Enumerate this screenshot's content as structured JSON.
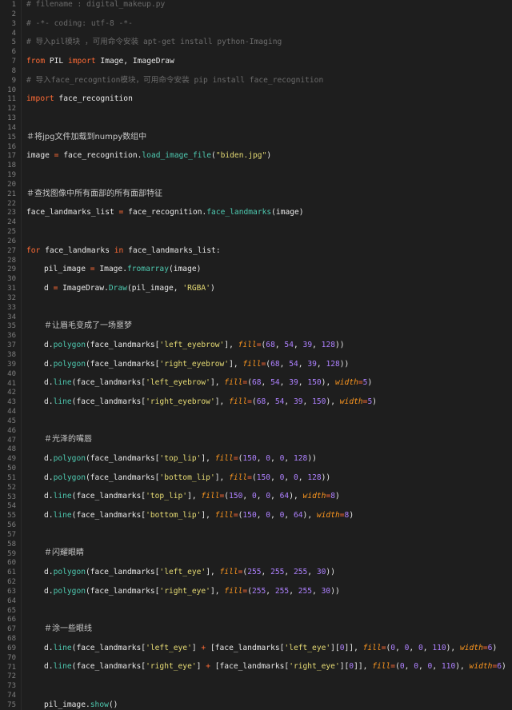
{
  "editor": {
    "line_numbers": [
      "1",
      "2",
      "3",
      "4",
      "5",
      "6",
      "7",
      "8",
      "9",
      "10",
      "11",
      "12",
      "13",
      "14",
      "15",
      "16",
      "17",
      "18",
      "19",
      "20",
      "21",
      "22",
      "23",
      "24",
      "25",
      "26",
      "27",
      "28",
      "29",
      "30",
      "31",
      "32",
      "33",
      "34",
      "35",
      "36",
      "37",
      "38",
      "39",
      "40",
      "41",
      "42",
      "43",
      "44",
      "45",
      "46",
      "47",
      "48",
      "49",
      "50",
      "51",
      "52",
      "53",
      "54",
      "55",
      "56",
      "57",
      "58",
      "59",
      "60",
      "61",
      "62",
      "63",
      "64",
      "65",
      "66",
      "67",
      "68",
      "69",
      "70",
      "71",
      "72",
      "73",
      "74",
      "75"
    ],
    "code": {
      "l1": "# filename : digital_makeup.py",
      "l3": "# -*- coding: utf-8 -*-",
      "l5": "# 导入pil模块 ，可用命令安装 apt-get install python-Imaging",
      "l7_kw1": "from",
      "l7_mid": " PIL ",
      "l7_kw2": "import",
      "l7_rest": " Image, ImageDraw",
      "l9": "# 导入face_recogntion模块，可用命令安装 pip install face_recognition",
      "l11_kw": "import",
      "l11_rest": " face_recognition",
      "l15": "＃将jpg文件加载到numpy数组中",
      "l17_a": "image ",
      "l17_op": "=",
      "l17_b": " face_recognition.",
      "l17_fn": "load_image_file",
      "l17_c": "(",
      "l17_str": "\"biden.jpg\"",
      "l17_d": ")",
      "l21": "＃查找图像中所有面部的所有面部特征",
      "l23_a": "face_landmarks_list ",
      "l23_op": "=",
      "l23_b": " face_recognition.",
      "l23_fn": "face_landmarks",
      "l23_c": "(image)",
      "l27_kw1": "for",
      "l27_a": " face_landmarks ",
      "l27_kw2": "in",
      "l27_b": " face_landmarks_list:",
      "l29_a": "pil_image ",
      "l29_op": "=",
      "l29_b": " Image.",
      "l29_fn": "fromarray",
      "l29_c": "(image)",
      "l31_a": "d ",
      "l31_op": "=",
      "l31_b": " ImageDraw.",
      "l31_fn": "Draw",
      "l31_c": "(pil_image, ",
      "l31_str": "'RGBA'",
      "l31_d": ")",
      "l35": "＃让眉毛变成了一场噩梦",
      "l37": [
        "d.",
        "polygon",
        "(face_landmarks[",
        "'left_eyebrow'",
        "], ",
        "fill",
        "=",
        "(",
        "68",
        ", ",
        "54",
        ", ",
        "39",
        ", ",
        "128",
        "))"
      ],
      "l39": [
        "d.",
        "polygon",
        "(face_landmarks[",
        "'right_eyebrow'",
        "], ",
        "fill",
        "=",
        "(",
        "68",
        ", ",
        "54",
        ", ",
        "39",
        ", ",
        "128",
        "))"
      ],
      "l41": [
        "d.",
        "line",
        "(face_landmarks[",
        "'left_eyebrow'",
        "], ",
        "fill",
        "=",
        "(",
        "68",
        ", ",
        "54",
        ", ",
        "39",
        ", ",
        "150",
        "), ",
        "width",
        "=",
        "5",
        ")"
      ],
      "l43": [
        "d.",
        "line",
        "(face_landmarks[",
        "'right_eyebrow'",
        "], ",
        "fill",
        "=",
        "(",
        "68",
        ", ",
        "54",
        ", ",
        "39",
        ", ",
        "150",
        "), ",
        "width",
        "=",
        "5",
        ")"
      ],
      "l47": "＃光泽的嘴唇",
      "l49": [
        "d.",
        "polygon",
        "(face_landmarks[",
        "'top_lip'",
        "], ",
        "fill",
        "=",
        "(",
        "150",
        ", ",
        "0",
        ", ",
        "0",
        ", ",
        "128",
        "))"
      ],
      "l51": [
        "d.",
        "polygon",
        "(face_landmarks[",
        "'bottom_lip'",
        "], ",
        "fill",
        "=",
        "(",
        "150",
        ", ",
        "0",
        ", ",
        "0",
        ", ",
        "128",
        "))"
      ],
      "l53": [
        "d.",
        "line",
        "(face_landmarks[",
        "'top_lip'",
        "], ",
        "fill",
        "=",
        "(",
        "150",
        ", ",
        "0",
        ", ",
        "0",
        ", ",
        "64",
        "), ",
        "width",
        "=",
        "8",
        ")"
      ],
      "l55": [
        "d.",
        "line",
        "(face_landmarks[",
        "'bottom_lip'",
        "], ",
        "fill",
        "=",
        "(",
        "150",
        ", ",
        "0",
        ", ",
        "0",
        ", ",
        "64",
        "), ",
        "width",
        "=",
        "8",
        ")"
      ],
      "l59": "＃闪耀眼睛",
      "l61": [
        "d.",
        "polygon",
        "(face_landmarks[",
        "'left_eye'",
        "], ",
        "fill",
        "=",
        "(",
        "255",
        ", ",
        "255",
        ", ",
        "255",
        ", ",
        "30",
        "))"
      ],
      "l63": [
        "d.",
        "polygon",
        "(face_landmarks[",
        "'right_eye'",
        "], ",
        "fill",
        "=",
        "(",
        "255",
        ", ",
        "255",
        ", ",
        "255",
        ", ",
        "30",
        "))"
      ],
      "l67": "＃涂一些眼线",
      "l69": [
        "d.",
        "line",
        "(face_landmarks[",
        "'left_eye'",
        "] ",
        "+",
        " [face_landmarks[",
        "'left_eye'",
        "][",
        "0",
        "]], ",
        "fill",
        "=",
        "(",
        "0",
        ", ",
        "0",
        ", ",
        "0",
        ", ",
        "110",
        "), ",
        "width",
        "=",
        "6",
        ")"
      ],
      "l71": [
        "d.",
        "line",
        "(face_landmarks[",
        "'right_eye'",
        "] ",
        "+",
        " [face_landmarks[",
        "'right_eye'",
        "][",
        "0",
        "]], ",
        "fill",
        "=",
        "(",
        "0",
        ", ",
        "0",
        ", ",
        "0",
        ", ",
        "110",
        "), ",
        "width",
        "=",
        "6",
        ")"
      ],
      "l75_a": "pil_image.",
      "l75_fn": "show",
      "l75_b": "()"
    }
  }
}
